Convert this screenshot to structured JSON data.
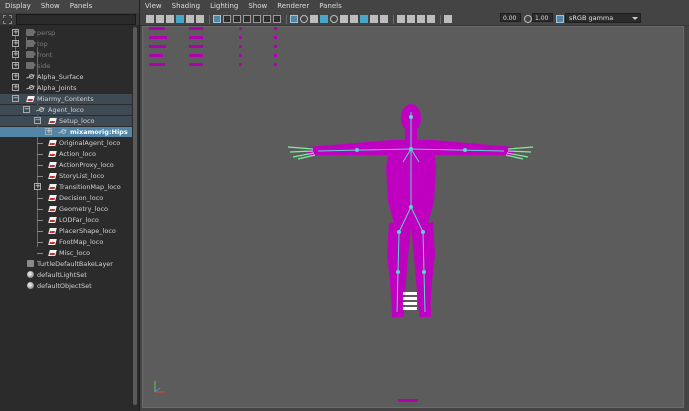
{
  "outliner": {
    "menu": [
      "Display",
      "Show",
      "Panels"
    ],
    "search_placeholder": "",
    "items": [
      {
        "label": "persp",
        "icon": "camera",
        "dim": true
      },
      {
        "label": "top",
        "icon": "camera",
        "dim": true
      },
      {
        "label": "front",
        "icon": "camera",
        "dim": true
      },
      {
        "label": "side",
        "icon": "camera",
        "dim": true
      },
      {
        "label": "Alpha_Surface",
        "icon": "joint"
      },
      {
        "label": "Alpha_Joints",
        "icon": "joint"
      },
      {
        "label": "Miarmy_Contents",
        "icon": "group"
      },
      {
        "label": "Agent_loco",
        "icon": "joint"
      },
      {
        "label": "Setup_loco",
        "icon": "group"
      },
      {
        "label": "mixamorig:Hips",
        "icon": "joint"
      },
      {
        "label": "OriginalAgent_loco",
        "icon": "group"
      },
      {
        "label": "Action_loco",
        "icon": "group"
      },
      {
        "label": "ActionProxy_loco",
        "icon": "group"
      },
      {
        "label": "StoryList_loco",
        "icon": "group"
      },
      {
        "label": "TransitionMap_loco",
        "icon": "group"
      },
      {
        "label": "Decision_loco",
        "icon": "group"
      },
      {
        "label": "Geometry_loco",
        "icon": "group"
      },
      {
        "label": "LODFar_loco",
        "icon": "group"
      },
      {
        "label": "PlacerShape_loco",
        "icon": "group"
      },
      {
        "label": "FootMap_loco",
        "icon": "group"
      },
      {
        "label": "Misc_loco",
        "icon": "group"
      },
      {
        "label": "TurtleDefaultBakeLayer",
        "icon": "layer"
      },
      {
        "label": "defaultLightSet",
        "icon": "set"
      },
      {
        "label": "defaultObjectSet",
        "icon": "set"
      }
    ]
  },
  "viewport": {
    "menu": [
      "View",
      "Shading",
      "Lighting",
      "Show",
      "Renderer",
      "Panels"
    ],
    "exposure": "0.00",
    "gamma": "1.00",
    "color_space": "sRGB gamma",
    "colors": {
      "mesh": "#c000c0",
      "skeleton": "#59d6c7",
      "hand": "#7cf09a",
      "background": "#5c5c5c"
    }
  }
}
